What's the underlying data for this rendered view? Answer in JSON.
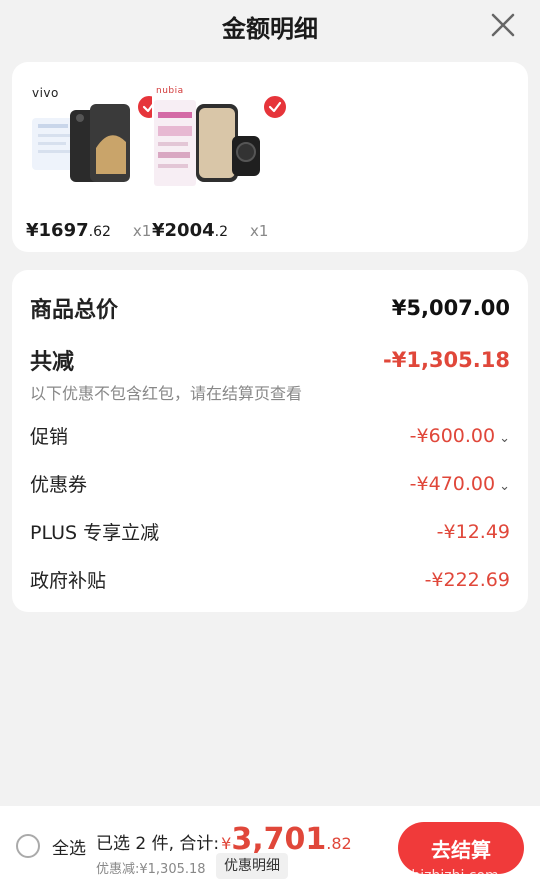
{
  "header": {
    "title": "金额明细"
  },
  "products": [
    {
      "brand": "vivo",
      "price_int": "¥1697",
      "price_dec": ".62",
      "qty": "x1",
      "colors": {
        "phone": "#2b2b2b",
        "panel": "#eef3fb"
      }
    },
    {
      "brand": "nubia",
      "price_int": "¥2004",
      "price_dec": ".2",
      "qty": "x1",
      "colors": {
        "phone": "#3a3a3a",
        "panel": "#f7eef4"
      }
    }
  ],
  "details": {
    "total_label": "商品总价",
    "total_value": "¥5,007.00",
    "reduce_label": "共减",
    "reduce_value": "-¥1,305.18",
    "note": "以下优惠不包含红包，请在结算页查看",
    "items": [
      {
        "label": "促销",
        "value": "-¥600.00",
        "expandable": true
      },
      {
        "label": "优惠券",
        "value": "-¥470.00",
        "expandable": true
      },
      {
        "label": "PLUS 专享立减",
        "value": "-¥12.49",
        "expandable": false
      },
      {
        "label": "政府补贴",
        "value": "-¥222.69",
        "expandable": false
      }
    ]
  },
  "bottom": {
    "select_all": "全选",
    "selected_text": "已选 2 件, 合计:",
    "currency": "¥",
    "total_int": "3,701",
    "total_dec": ".82",
    "savings": "优惠减:¥1,305.18",
    "detail_button": "优惠明细",
    "checkout_button": "去结算"
  },
  "watermark": "zhizhizhi.com",
  "colors": {
    "accent": "#e0473a",
    "button": "#f03a3a"
  }
}
